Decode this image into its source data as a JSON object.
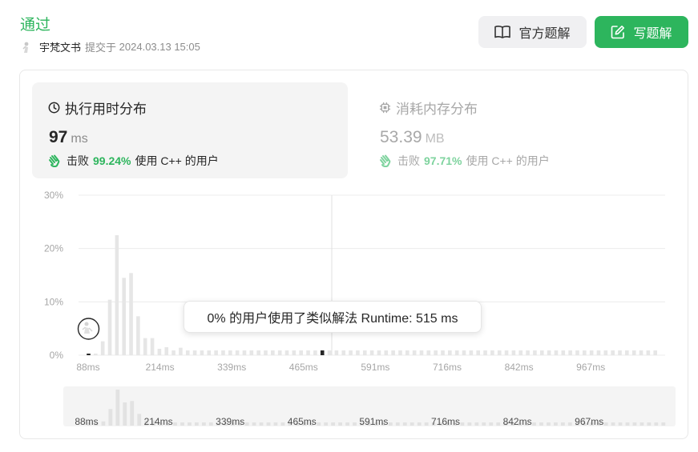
{
  "header": {
    "status": "通过",
    "username": "宇梵文书",
    "submitted_label": "提交于",
    "submitted_time": "2024.03.13 15:05",
    "official_solution_label": "官方题解",
    "write_solution_label": "写题解"
  },
  "runtime_card": {
    "title": "执行用时分布",
    "value": "97",
    "unit": "ms",
    "beats_label": "击败",
    "beats_pct": "99.24%",
    "beats_suffix": "使用 C++ 的用户"
  },
  "memory_card": {
    "title": "消耗内存分布",
    "value": "53.39",
    "unit": "MB",
    "beats_label": "击败",
    "beats_pct": "97.71%",
    "beats_suffix": "使用 C++ 的用户"
  },
  "tooltip": {
    "text": "0% 的用户使用了类似解法 Runtime: 515 ms"
  },
  "colors": {
    "accent": "#2db55d",
    "bar": "#e6e6e6",
    "highlight_bar": "#262626"
  },
  "chart_data": {
    "type": "bar",
    "y_tick_labels": [
      "0%",
      "10%",
      "20%",
      "30%"
    ],
    "ylim": [
      0,
      30
    ],
    "x_tick_labels": [
      "88ms",
      "214ms",
      "339ms",
      "465ms",
      "591ms",
      "716ms",
      "842ms",
      "967ms"
    ],
    "values": [
      0.3,
      0.3,
      2.6,
      10.4,
      22.5,
      14.5,
      15.4,
      7.3,
      3.2,
      3.2,
      1.2,
      1.5,
      0.9,
      1.4,
      0.9,
      0.9,
      0.9,
      0.9,
      0.9,
      0.9,
      0.9,
      0.9,
      0.9,
      0.9,
      0.9,
      0.9,
      0.9,
      0.9,
      0.9,
      0.9,
      0.9,
      0.9,
      0.9,
      0.9,
      0.9,
      0.9,
      0.9,
      0.9,
      0.9,
      0.9,
      0.9,
      0.9,
      0.9,
      0.9,
      0.9,
      0.9,
      0.9,
      0.9,
      0.9,
      0.9,
      0.9,
      0.9,
      0.9,
      0.9,
      0.9,
      0.9,
      0.9,
      0.9,
      0.9,
      0.9,
      0.9,
      0.9,
      0.9,
      0.9,
      0.9,
      0.9,
      0.9,
      0.9,
      0.9,
      0.9,
      0.9,
      0.9,
      0.9,
      0.9,
      0.9,
      0.9,
      0.9,
      0.9,
      0.9,
      0.9,
      0.9
    ],
    "your_runtime_index": 0,
    "hover_index": 33,
    "grid": true
  }
}
